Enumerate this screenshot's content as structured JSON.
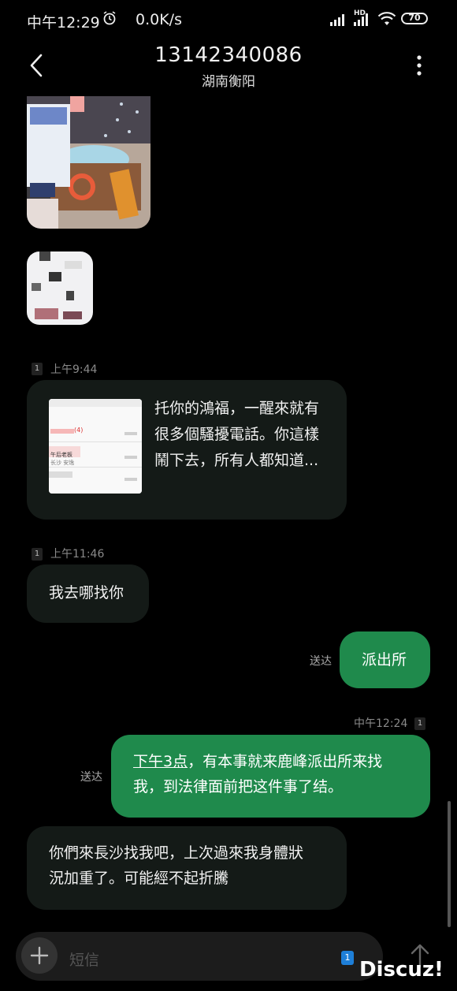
{
  "status_bar": {
    "time": "中午12:29",
    "net_speed": "0.0K/s",
    "hd": "HD",
    "battery": "70"
  },
  "header": {
    "phone_number": "13142340086",
    "location": "湖南衡阳"
  },
  "messages": {
    "m1": {
      "sim": "1",
      "time": "上午9:44",
      "text_line1": "托你的鴻福，一醒來就有",
      "text_line2": "很多個騷擾電話。你這樣",
      "text_line3": "鬧下去，所有人都知道..."
    },
    "m2": {
      "sim": "1",
      "time": "上午11:46",
      "text": "我去哪找你"
    },
    "m3": {
      "status": "送达",
      "text": "派出所"
    },
    "m4": {
      "time": "中午12:24",
      "sim": "1",
      "status": "送达",
      "link_text": "下午3点",
      "text_rest_line1": "，有本事就来鹿峰派出所来找",
      "text_line2": "我，到法律面前把这件事了结。"
    },
    "m5": {
      "text_line1": "你們來長沙找我吧，上次過來我身體狀",
      "text_line2": "況加重了。可能經不起折騰"
    }
  },
  "preview": {
    "line_a": "(4)",
    "line_b": "午后老板",
    "line_c": "长沙 安逸"
  },
  "composer": {
    "placeholder": "短信",
    "sim": "1"
  },
  "watermark": "Discuz!"
}
